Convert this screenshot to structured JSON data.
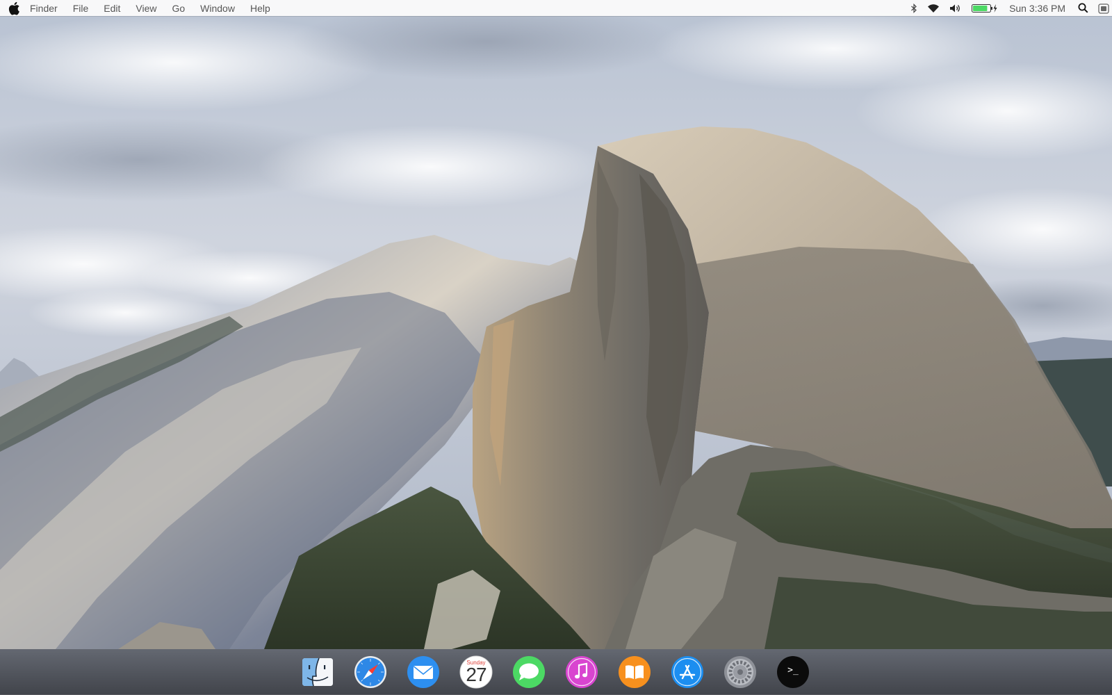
{
  "menubar": {
    "app_name": "Finder",
    "items": [
      "File",
      "Edit",
      "View",
      "Go",
      "Window",
      "Help"
    ],
    "clock": "Sun 3:36 PM",
    "battery_level": 0.85,
    "status_icons": [
      "bluetooth-icon",
      "wifi-icon",
      "volume-icon",
      "battery-icon",
      "search-icon",
      "notification-center-icon"
    ]
  },
  "dock": {
    "apps": [
      {
        "name": "finder",
        "icon": "finder-icon"
      },
      {
        "name": "safari",
        "icon": "safari-icon"
      },
      {
        "name": "mail",
        "icon": "mail-icon"
      },
      {
        "name": "calendar",
        "icon": "calendar-icon",
        "day": "Sunday",
        "date": "27"
      },
      {
        "name": "messages",
        "icon": "messages-icon"
      },
      {
        "name": "itunes",
        "icon": "itunes-icon"
      },
      {
        "name": "ibooks",
        "icon": "ibooks-icon"
      },
      {
        "name": "app-store",
        "icon": "app-store-icon"
      },
      {
        "name": "system-preferences",
        "icon": "system-preferences-icon"
      },
      {
        "name": "terminal",
        "icon": "terminal-icon",
        "prompt": ">_"
      }
    ]
  },
  "colors": {
    "sky": "#c9d0dc",
    "granite": "#a9a195",
    "forest": "#3c4a34",
    "safari_blue": "#2e88e6",
    "messages_green": "#4cd964",
    "itunes_pink": "#d945d0",
    "ibooks_orange": "#f7901e",
    "battery_green": "#4cd964"
  }
}
